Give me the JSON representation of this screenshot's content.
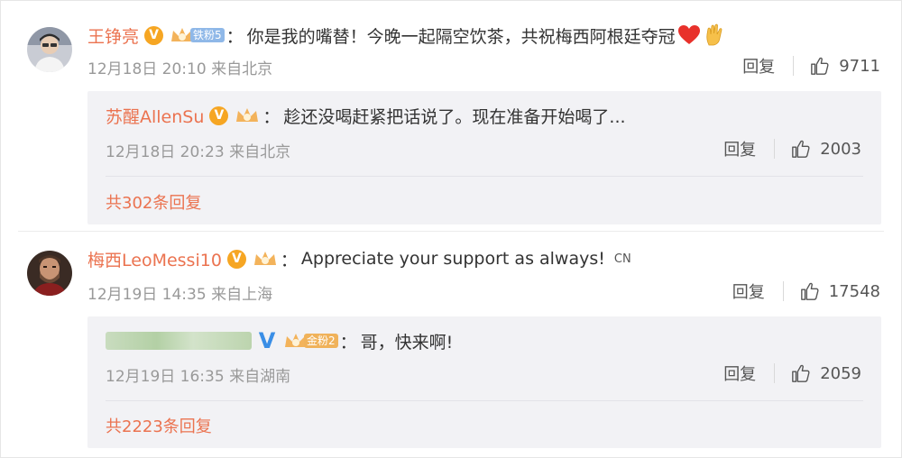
{
  "comments": [
    {
      "user": "王铮亮",
      "fan_label": "铁粉5",
      "text": "你是我的嘴替！今晚一起隔空饮茶，共祝梅西阿根廷夺冠",
      "time": "12月18日 20:10",
      "source": "来自北京",
      "reply_label": "回复",
      "likes": "9711",
      "avatar_icon": "avatar-photo-icon",
      "emoji_icons": [
        "heart-icon",
        "hand-gesture-icon"
      ],
      "reply": {
        "user": "苏醒AllenSu",
        "text": "趁还没喝赶紧把话说了。现在准备开始喝了...",
        "time": "12月18日 20:23",
        "source": "来自北京",
        "reply_label": "回复",
        "likes": "2003"
      },
      "more_replies": "共302条回复"
    },
    {
      "user": "梅西LeoMessi10",
      "text": "Appreciate your support as always!",
      "translate_tag": "CN",
      "time": "12月19日 14:35",
      "source": "来自上海",
      "reply_label": "回复",
      "likes": "17548",
      "avatar_icon": "avatar-photo-icon",
      "reply": {
        "user_blurred": true,
        "fan_label": "金粉2",
        "text": "哥，快来啊!",
        "time": "12月19日 16:35",
        "source": "来自湖南",
        "reply_label": "回复",
        "likes": "2059"
      },
      "more_replies": "共2223条回复"
    }
  ],
  "colors": {
    "username": "#eb7350",
    "meta": "#999999",
    "reply_bg": "#f2f2f5",
    "verified_gold": "#f6a623",
    "verified_blue": "#3a8ee6"
  }
}
